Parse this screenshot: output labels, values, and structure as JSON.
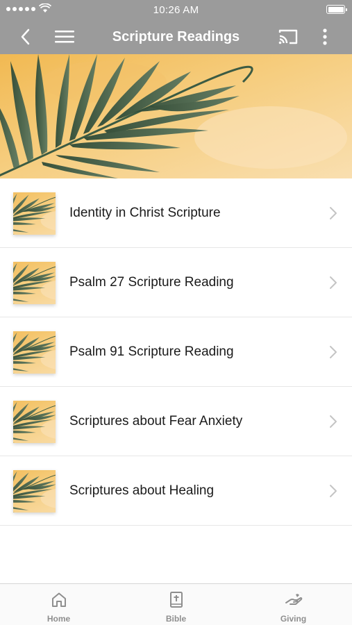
{
  "status_bar": {
    "time": "10:26 AM"
  },
  "header": {
    "title": "Scripture Readings",
    "icons": {
      "back": "chevron-left-icon",
      "menu": "hamburger-menu-icon",
      "cast": "cast-icon",
      "more": "more-vertical-icon"
    },
    "bar_color": "#9b9b9b"
  },
  "banner": {
    "image": "palm-leaf-on-yellow-watercolor"
  },
  "list": {
    "items": [
      {
        "label": "Identity in Christ Scripture"
      },
      {
        "label": "Psalm 27 Scripture Reading"
      },
      {
        "label": "Psalm 91 Scripture Reading"
      },
      {
        "label": "Scriptures about Fear Anxiety"
      },
      {
        "label": "Scriptures about Healing"
      }
    ]
  },
  "tab_bar": {
    "tabs": [
      {
        "label": "Home",
        "icon": "home-icon"
      },
      {
        "label": "Bible",
        "icon": "bible-icon"
      },
      {
        "label": "Giving",
        "icon": "giving-hand-icon"
      }
    ]
  }
}
